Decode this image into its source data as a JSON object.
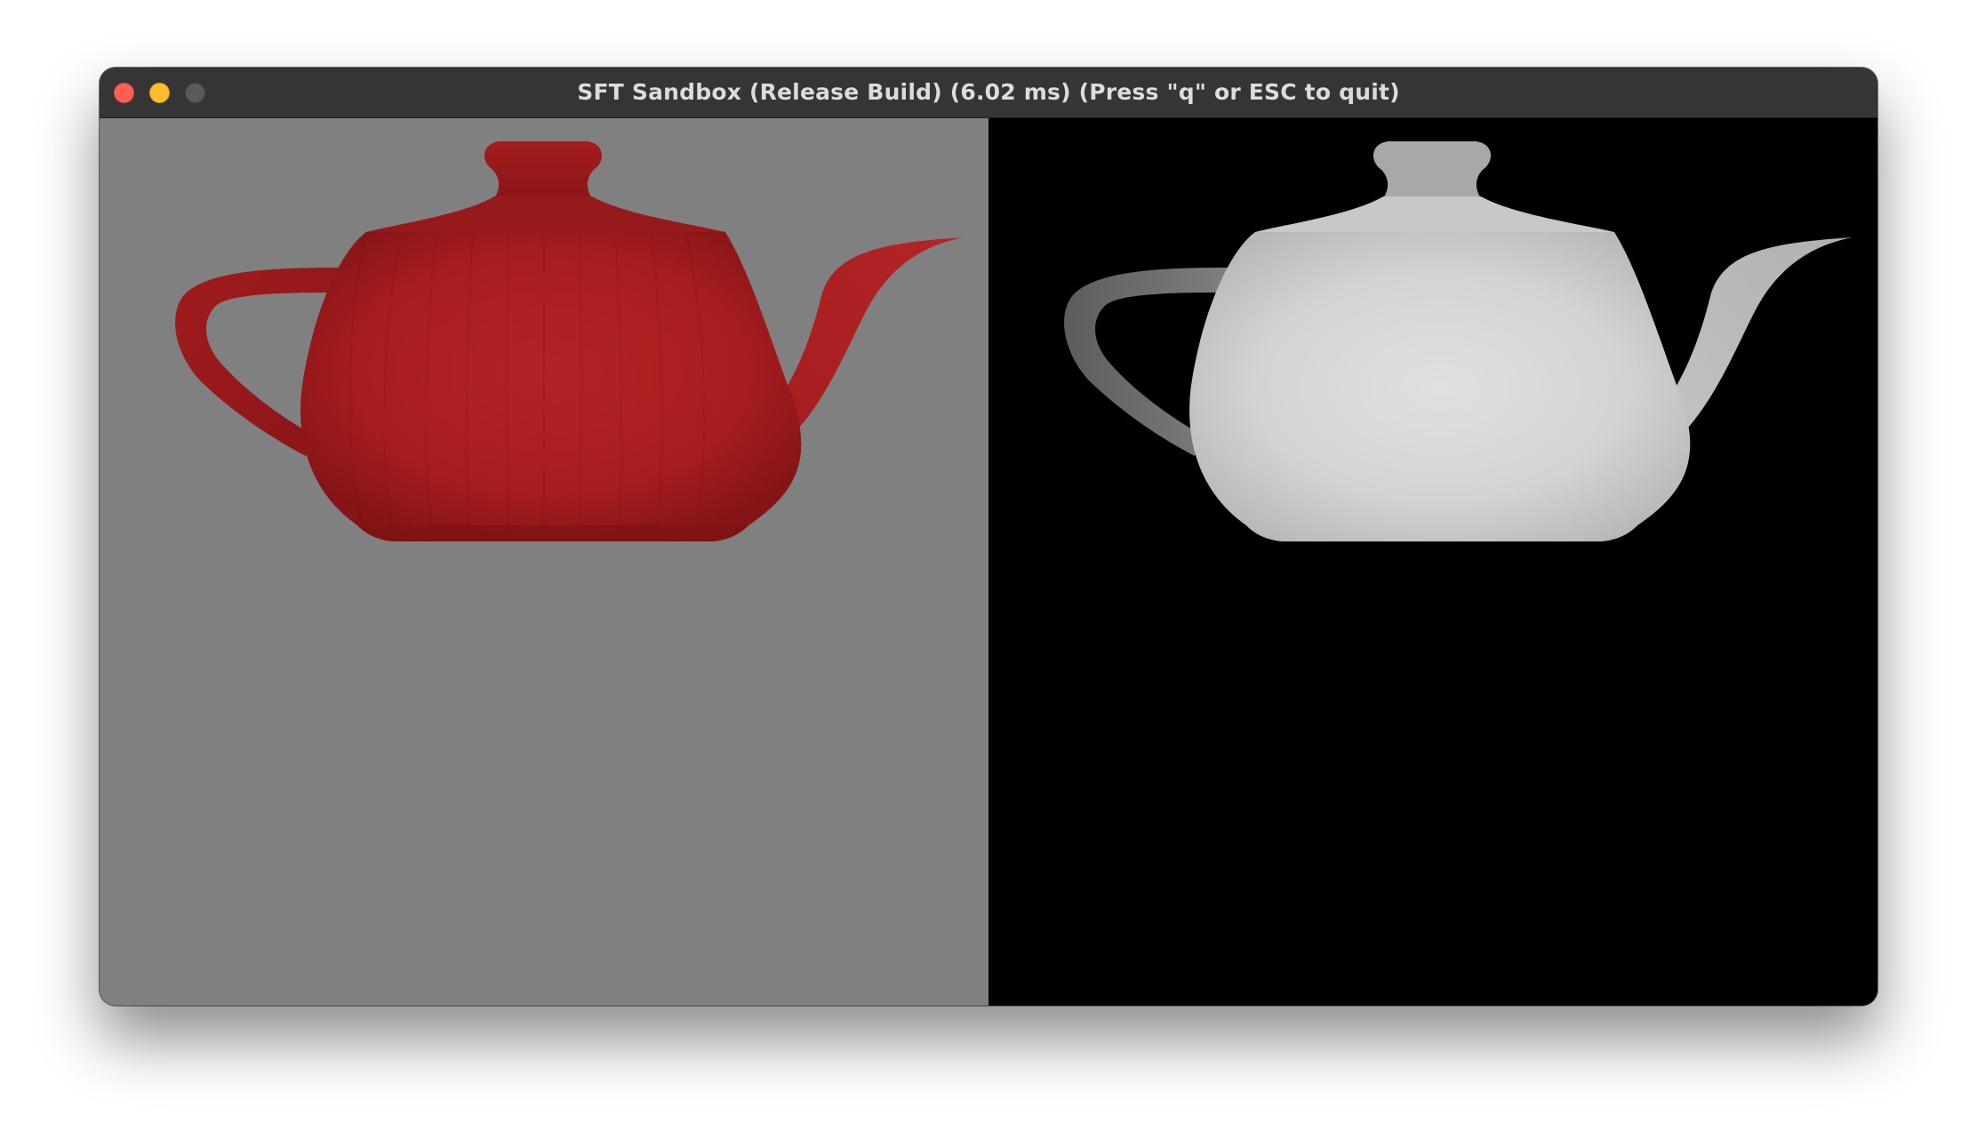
{
  "window": {
    "title": "SFT Sandbox (Release Build) (6.02 ms) (Press \"q\" or ESC to quit)",
    "traffic_lights": [
      "close-button",
      "minimize-button",
      "zoom-button"
    ]
  },
  "viewports": {
    "left": {
      "content": "shaded-teapot",
      "background": "#808080",
      "object_color": "#b01e20"
    },
    "right": {
      "content": "depth-teapot",
      "background": "#000000",
      "object_color": "#d8d8d8"
    }
  },
  "colors": {
    "close": "#ff5f57",
    "minimize": "#febc2e",
    "zoom": "#5a5a5a",
    "titlebar": "#353535"
  }
}
